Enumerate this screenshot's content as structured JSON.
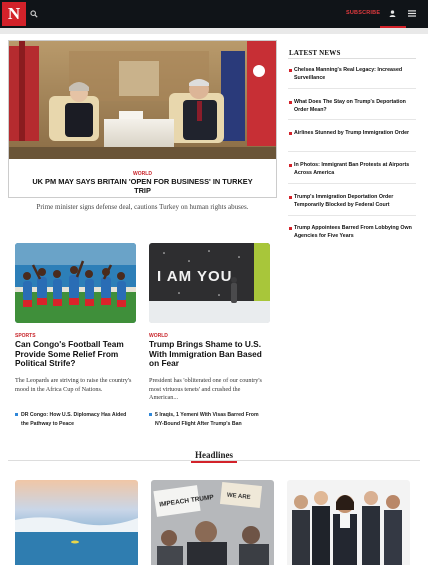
{
  "header": {
    "logo_letter": "N",
    "subscribe_label": "SUBSCRIBE",
    "brand_color": "#d3222a"
  },
  "hero": {
    "kicker": "WORLD",
    "title": "UK PM MAY SAYS BRITAIN 'OPEN FOR BUSINESS' IN TURKEY TRIP",
    "dek": "Prime minister signs defense deal, cautions Turkey on human rights abuses."
  },
  "stories": [
    {
      "kicker": "SPORTS",
      "title": "Can Congo's Football Team Provide Some Relief From Political Strife?",
      "dek": "The Leopards are striving to raise the country's mood in the Africa Cup of Nations.",
      "related": [
        "DR Congo: How U.S. Diplomacy Has Aided the Pathway to Peace"
      ]
    },
    {
      "kicker": "WORLD",
      "title": "Trump Brings Shame to U.S. With Immigration Ban Based on Fear",
      "dek": "President has 'obliterated one of our country's most virtuous tenets' and crushed the American...",
      "related": [
        "5 Iraqis, 1 Yemeni With Visas Barred From NY-Bound Flight After Trump's Ban"
      ],
      "image_text": "I AM YOU"
    }
  ],
  "headlines_label": "Headlines",
  "bottom_images": {
    "protest_signs": [
      "IMPEACH TRUMP",
      "WE ARE"
    ]
  },
  "sidebar": {
    "title": "LATEST NEWS",
    "items": [
      "Chelsea Manning's Real Legacy: Increased Surveillance",
      "What Does The Stay on Trump's Deportation Order Mean?",
      "Airlines Stunned by Trump Immigration Order",
      "In Photos: Immigrant Ban Protests at Airports Across America",
      "Trump's Immigration Deportation Order Temporarily Blocked by Federal Court",
      "Trump Appointees Barred From Lobbying Own Agencies for Five Years"
    ]
  },
  "icons": {
    "search": "search-icon",
    "user": "user-icon",
    "menu": "menu-icon"
  }
}
